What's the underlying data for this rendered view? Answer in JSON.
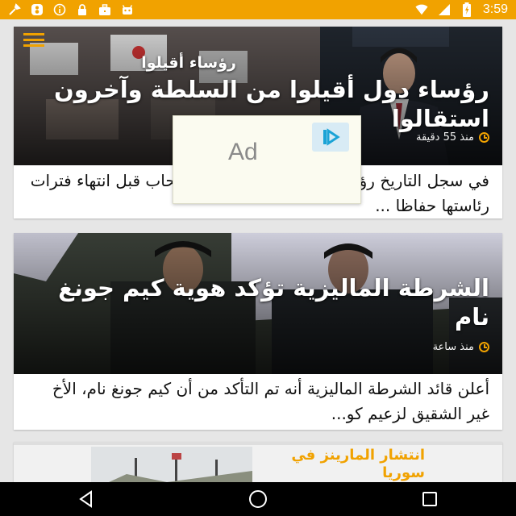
{
  "status_bar": {
    "time": "3:59",
    "left_icons": [
      "tools-icon",
      "number-8-icon",
      "info-icon",
      "lock-icon",
      "briefcase-icon",
      "android-icon"
    ],
    "right_icons": [
      "wifi-icon",
      "signal-icon",
      "battery-icon"
    ]
  },
  "colors": {
    "accent": "#f1a200",
    "nav_bg": "#000000",
    "card_bg": "#ffffff",
    "page_bg": "#e6e6e6"
  },
  "articles": [
    {
      "overlay_subtitle": "رؤساء أقيلوا",
      "title": "رؤساء دول أقيلوا من السلطة وآخرون استقالوا",
      "time_ago": "منذ 55 دقيقة",
      "excerpt": "في سجل التاريخ رؤساء دول كثيرة فضلت الانسحاب قبل انتهاء فترات رئاستها حفاظا ..."
    },
    {
      "title": "الشرطة الماليزية تؤكد هوية كيم جونغ نام",
      "time_ago": "منذ ساعة",
      "excerpt": "أعلن قائد الشرطة الماليزية أنه تم التأكد من أن كيم جونغ نام، الأخ غير الشقيق لزعيم كو..."
    },
    {
      "title": "انتشار المارينز في سوريا"
    }
  ],
  "ad": {
    "label": "Ad"
  },
  "nav": {
    "back": "back-icon",
    "home": "home-icon",
    "recents": "recents-icon"
  }
}
